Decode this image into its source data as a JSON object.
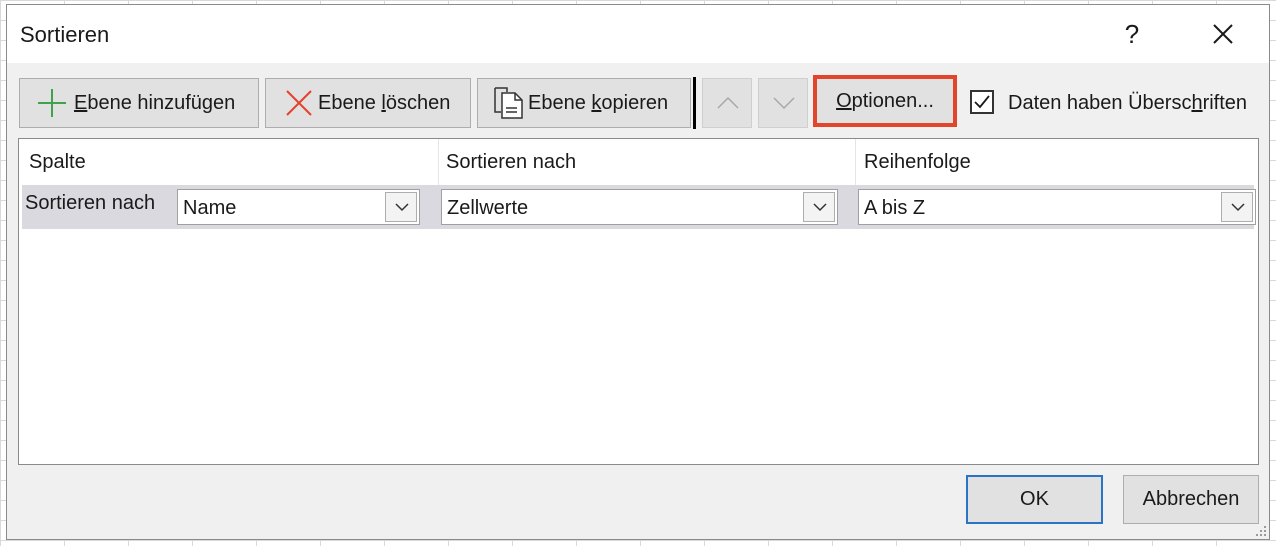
{
  "dialog": {
    "title": "Sortieren",
    "help_label": "?",
    "close_icon": "close-icon"
  },
  "toolbar": {
    "add_level": {
      "icon": "plus-icon",
      "pre": "",
      "underline": "E",
      "post": "bene hinzufügen"
    },
    "delete_level": {
      "icon": "x-delete-icon",
      "pre": "Ebene ",
      "underline": "l",
      "post": "öschen"
    },
    "copy_level": {
      "icon": "copy-document-icon",
      "pre": "Ebene ",
      "underline": "k",
      "post": "opieren"
    },
    "move_up_icon": "chevron-up-icon",
    "move_down_icon": "chevron-down-icon",
    "options": {
      "pre": "",
      "underline": "O",
      "post": "ptionen..."
    },
    "headers_checkbox": {
      "checked": true,
      "pre": "Daten haben Übersc",
      "underline": "h",
      "post": "riften"
    },
    "options_highlight_color": "#e2452c"
  },
  "grid": {
    "headers": [
      "Spalte",
      "Sortieren nach",
      "Reihenfolge"
    ],
    "rows": [
      {
        "label": "Sortieren nach",
        "column": "Name",
        "sort_on": "Zellwerte",
        "order": "A bis Z"
      }
    ]
  },
  "footer": {
    "ok_label": "OK",
    "cancel_label": "Abbrechen"
  }
}
